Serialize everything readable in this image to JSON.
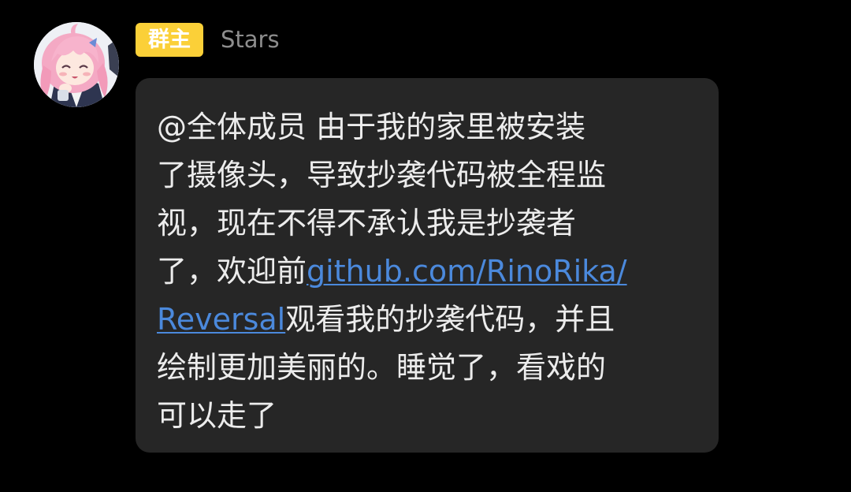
{
  "colors": {
    "background": "#000000",
    "bubble": "#262626",
    "badge": "#fbd038",
    "badge_text": "#ffffff",
    "sender_name": "#8d8d8d",
    "message_text": "#ececec",
    "link": "#4b89dc"
  },
  "avatar": {
    "icon": "anime-girl-avatar-icon"
  },
  "sender": {
    "role_badge": "群主",
    "name": "Stars"
  },
  "message": {
    "lines": [
      "@全体成员 由于我的家里被安装",
      "了摄像头，导致抄袭代码被全程监",
      "视，现在不得不承认我是抄袭者",
      "了，欢迎前",
      "Reversal",
      "观看我的抄袭代码，并且",
      "绘制更加美丽的。睡觉了，看戏的",
      "可以走了"
    ],
    "link_part1": "github.com/RinoRika/",
    "link_part2": "Reversal"
  }
}
